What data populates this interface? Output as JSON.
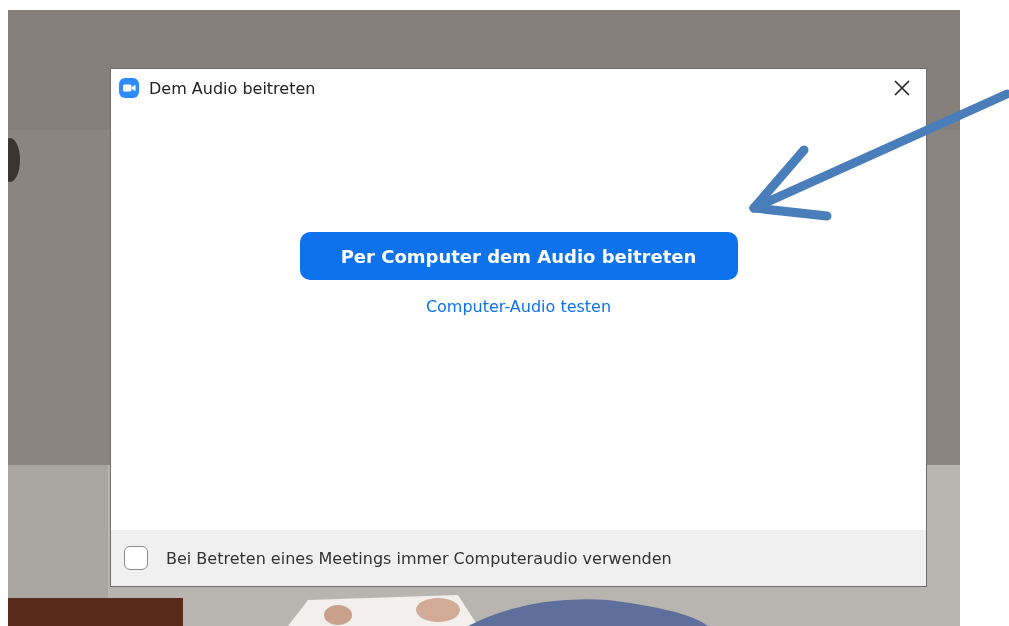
{
  "dialog": {
    "title": "Dem Audio beitreten",
    "join_button": "Per Computer dem Audio beitreten",
    "test_link": "Computer-Audio testen",
    "always_use_checkbox": {
      "label": "Bei Betreten eines Meetings immer Computeraudio verwenden",
      "checked": false
    }
  }
}
